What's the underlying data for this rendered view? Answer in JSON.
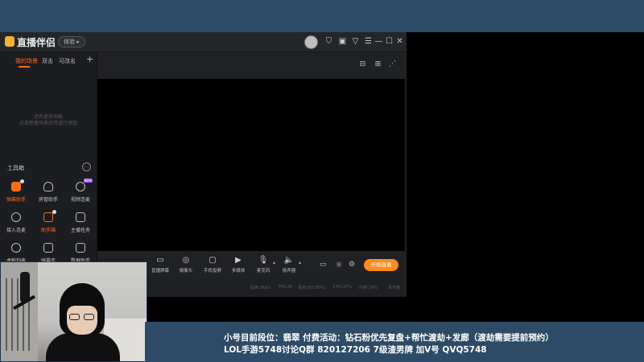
{
  "app": {
    "title": "直播伴侣",
    "beta_badge": "体验",
    "sidebar": {
      "tabs": [
        "我的场景",
        "双击",
        "可改名"
      ],
      "add_label": "+",
      "empty_line1": "还有更多功能",
      "empty_line2": "点击新建场景后可进行添加",
      "tools_title": "工具箱",
      "tools": [
        {
          "label": "弹幕助手",
          "icon": "danmaku-icon",
          "active": true
        },
        {
          "label": "房管助手",
          "icon": "room-manager-icon",
          "active": false
        },
        {
          "label": "视频连麦",
          "icon": "video-link-icon",
          "active": false,
          "badge": "NEW"
        },
        {
          "label": "接入连麦",
          "icon": "download-icon",
          "active": false
        },
        {
          "label": "助手箱",
          "icon": "toolbox-icon",
          "active": true
        },
        {
          "label": "主播任务",
          "icon": "task-icon",
          "active": false
        },
        {
          "label": "虎粉列表",
          "icon": "fans-icon",
          "active": false
        },
        {
          "label": "弹幕库",
          "icon": "tv-icon",
          "active": false
        },
        {
          "label": "数据助手",
          "icon": "data-icon",
          "active": false
        }
      ]
    },
    "controls": [
      {
        "label": "直播屏幕",
        "icon": "screen-icon"
      },
      {
        "label": "摄像头",
        "icon": "camera-icon"
      },
      {
        "label": "手机投屏",
        "icon": "phone-cast-icon"
      },
      {
        "label": "多媒体",
        "icon": "media-icon"
      },
      {
        "label": "麦克风",
        "icon": "microphone-icon"
      },
      {
        "label": "扬声器",
        "icon": "speaker-icon"
      }
    ],
    "start_button": "开始直播",
    "status": [
      "码率:0kb/s",
      "FPS:30",
      "丢帧:0(0.00%)",
      "CPU:37%",
      "内存:24%",
      "未开播"
    ]
  },
  "overlay": {
    "line1": "小号目前段位：翡翠    付费活动：钻石粉优先复盘+帮忙渡劫+发廊（渡劫需要提前预约）",
    "line2": "LOL手游5748讨论Q群 820127206  7级渣男牌 加V号 QVQ5748"
  },
  "colors": {
    "accent": "#ff6b1c",
    "start_button": "#ff8a1f",
    "band": "#2d4b66",
    "app_bg": "#1f2023"
  }
}
